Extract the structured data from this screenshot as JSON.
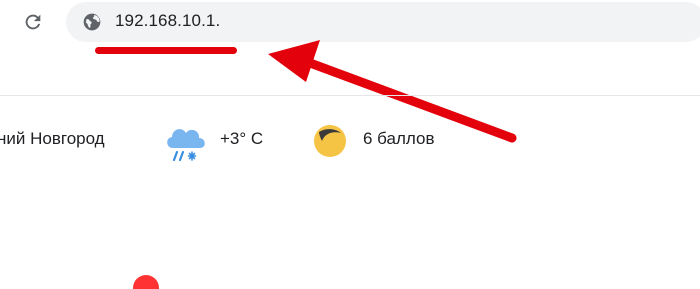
{
  "browser": {
    "reload_icon": "reload-icon",
    "site_info_icon": "globe-icon",
    "address_bar": {
      "url": "192.168.10.1."
    }
  },
  "annotation": {
    "underline_color": "#e3020b",
    "arrow_color": "#e3020b"
  },
  "info_bar": {
    "city": "ний Новгород",
    "weather_icon": "cloud-snow-icon",
    "temperature": "+3° C",
    "traffic_icon": "traffic-moon-icon",
    "traffic_score": "6 баллов"
  }
}
